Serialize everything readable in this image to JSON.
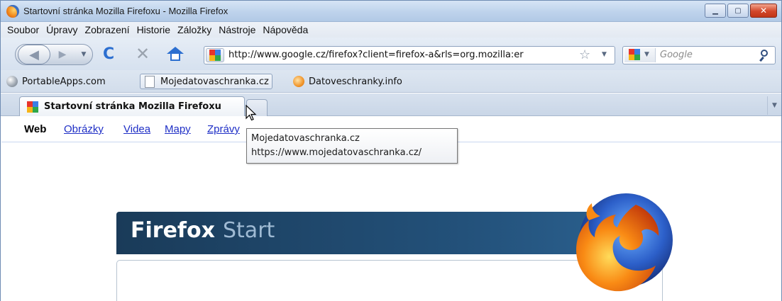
{
  "window": {
    "title": "Startovní stránka Mozilla Firefoxu - Mozilla Firefox",
    "controls": {
      "minimize": "▁",
      "maximize": "▢",
      "close": "✕"
    }
  },
  "menu": [
    "Soubor",
    "Úpravy",
    "Zobrazení",
    "Historie",
    "Záložky",
    "Nástroje",
    "Nápověda"
  ],
  "toolbar": {
    "back_icon": "back-arrow-icon",
    "forward_icon": "forward-arrow-icon",
    "reload_glyph": "C",
    "stop_glyph": "✕",
    "url": "http://www.google.cz/firefox?client=firefox-a&rls=org.mozilla:er",
    "search_placeholder": "Google"
  },
  "bookmarks": [
    {
      "label": "PortableApps.com"
    },
    {
      "label": "Mojedatovaschranka.cz"
    },
    {
      "label": "Datoveschranky.info"
    }
  ],
  "tabs": [
    {
      "label": "Startovní stránka Mozilla Firefoxu",
      "active": true
    }
  ],
  "google_nav": {
    "current": "Web",
    "links": [
      "Obrázky",
      "Videa",
      "Mapy",
      "Zprávy"
    ]
  },
  "firefox_start": {
    "brand": "Firefox",
    "suffix": "Start"
  },
  "tooltip": {
    "title": "Mojedatovaschranka.cz",
    "url": "https://www.mojedatovaschranka.cz/"
  },
  "colors": {
    "accent": "#2c6fd0",
    "link": "#1f2fc6",
    "banner": "#1a3b59"
  }
}
